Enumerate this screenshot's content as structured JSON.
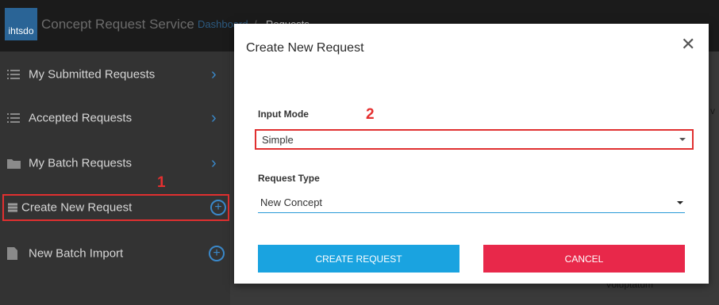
{
  "header": {
    "logo_text": "ihtsdo",
    "app_title": "Concept Request Service",
    "breadcrumb_link": "Dashboard",
    "breadcrumb_separator": "/",
    "breadcrumb_current": "Requests"
  },
  "sidebar": {
    "items": [
      {
        "label": "My Submitted Requests",
        "icon": "list-icon",
        "action": "chevron-right-icon"
      },
      {
        "label": "Accepted Requests",
        "icon": "list-icon",
        "action": "chevron-right-icon"
      },
      {
        "label": "My Batch Requests",
        "icon": "folder-icon",
        "action": "chevron-right-icon"
      },
      {
        "label": "Create New Request",
        "icon": "table-icon",
        "action": "plus-circle-icon"
      },
      {
        "label": "New Batch Import",
        "icon": "file-icon",
        "action": "plus-circle-icon"
      }
    ]
  },
  "annotations": {
    "marker_1": "1",
    "marker_2": "2"
  },
  "background": {
    "partial_text": "Voluptatum",
    "partial_column": "v"
  },
  "modal": {
    "title": "Create New Request",
    "close_glyph": "✕",
    "input_mode": {
      "label": "Input Mode",
      "value": "Simple"
    },
    "request_type": {
      "label": "Request Type",
      "value": "New Concept"
    },
    "create_button": "CREATE REQUEST",
    "cancel_button": "CANCEL"
  },
  "colors": {
    "primary": "#1aa3e0",
    "danger": "#e8284a",
    "highlight": "#e03030",
    "link": "#3a88c9"
  }
}
